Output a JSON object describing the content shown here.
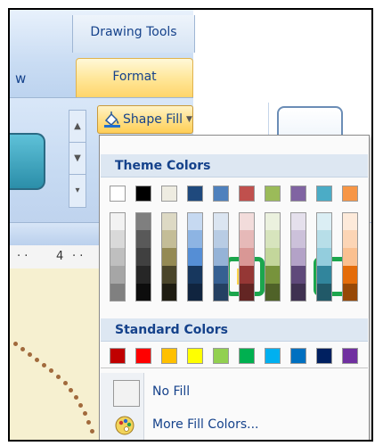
{
  "ribbon": {
    "contextual_group": "Drawing Tools",
    "left_tab_fragment": "w",
    "active_tab": "Format",
    "ruler_number": "4"
  },
  "shape_fill": {
    "label": "Shape Fill",
    "icon": "paint-bucket-icon"
  },
  "menu": {
    "theme_colors_title": "Theme Colors",
    "standard_colors_title": "Standard Colors",
    "no_fill_label": "No Fill",
    "more_colors_label": "More Fill Colors...",
    "more_colors_icon": "palette-icon"
  },
  "theme_top_row": [
    "#FFFFFF",
    "#000000",
    "#EEECE1",
    "#1F497D",
    "#4F81BD",
    "#C0504D",
    "#9BBB59",
    "#8064A2",
    "#4BACC6",
    "#F79646"
  ],
  "theme_shades": [
    [
      "#F2F2F2",
      "#D9D9D9",
      "#BFBFBF",
      "#A6A6A6",
      "#808080"
    ],
    [
      "#7F7F7F",
      "#595959",
      "#404040",
      "#262626",
      "#0D0D0D"
    ],
    [
      "#DDD9C4",
      "#C4BD97",
      "#948A54",
      "#4A452A",
      "#1E1C11"
    ],
    [
      "#C6D9F1",
      "#8DB4E3",
      "#558ED5",
      "#17375E",
      "#10243F"
    ],
    [
      "#DBE5F1",
      "#B8CCE4",
      "#95B3D7",
      "#366092",
      "#244062"
    ],
    [
      "#F2DCDB",
      "#E6B9B8",
      "#D99795",
      "#953735",
      "#632523"
    ],
    [
      "#EBF1DE",
      "#D7E4BD",
      "#C3D69B",
      "#77933C",
      "#4F6228"
    ],
    [
      "#E5E0EC",
      "#CCC1DA",
      "#B3A2C7",
      "#5F497A",
      "#3F3151"
    ],
    [
      "#DBEEF4",
      "#B7DEE8",
      "#93CDDD",
      "#31859C",
      "#215968"
    ],
    [
      "#FDEADA",
      "#FCD5B5",
      "#FAC090",
      "#E46C0A",
      "#974806"
    ]
  ],
  "standard_colors": [
    "#C00000",
    "#FF0000",
    "#FFC000",
    "#FFFF00",
    "#92D050",
    "#00B050",
    "#00B0F0",
    "#0070C0",
    "#002060",
    "#7030A0"
  ],
  "highlight_color": "#1CA64D"
}
